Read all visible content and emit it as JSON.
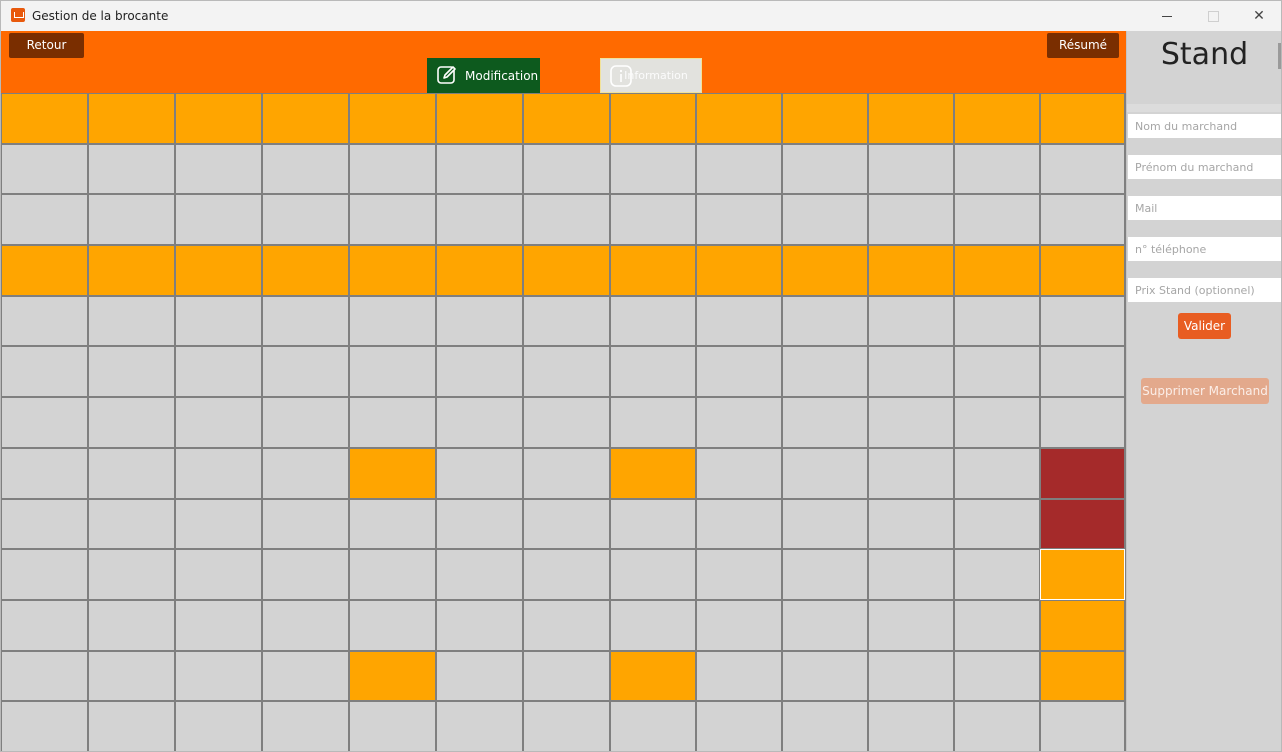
{
  "window": {
    "title": "Gestion de la brocante"
  },
  "toolbar": {
    "back_label": "Retour",
    "summary_label": "Résumé",
    "tab_modification": "Modification",
    "tab_information": "Information"
  },
  "panel": {
    "title": "Stand",
    "fields": {
      "nom_placeholder": "Nom du marchand",
      "prenom_placeholder": "Prénom du marchand",
      "mail_placeholder": "Mail",
      "telephone_placeholder": "n° téléphone",
      "prix_placeholder": "Prix Stand (optionnel)"
    },
    "validate_label": "Valider",
    "delete_label": "Supprimer Marchand"
  },
  "grid": {
    "rows": 13,
    "cols": 13,
    "colors": {
      "empty": "#d3d3d3",
      "stand": "#ffa500",
      "occupied": "#a52a2a"
    },
    "cells": [
      [
        "stand",
        "stand",
        "stand",
        "stand",
        "stand",
        "stand",
        "stand",
        "stand",
        "stand",
        "stand",
        "stand",
        "stand",
        "stand"
      ],
      [
        "empty",
        "empty",
        "empty",
        "empty",
        "empty",
        "empty",
        "empty",
        "empty",
        "empty",
        "empty",
        "empty",
        "empty",
        "empty"
      ],
      [
        "empty",
        "empty",
        "empty",
        "empty",
        "empty",
        "empty",
        "empty",
        "empty",
        "empty",
        "empty",
        "empty",
        "empty",
        "empty"
      ],
      [
        "stand",
        "stand",
        "stand",
        "stand",
        "stand",
        "stand",
        "stand",
        "stand",
        "stand",
        "stand",
        "stand",
        "stand",
        "stand"
      ],
      [
        "empty",
        "empty",
        "empty",
        "empty",
        "empty",
        "empty",
        "empty",
        "empty",
        "empty",
        "empty",
        "empty",
        "empty",
        "empty"
      ],
      [
        "empty",
        "empty",
        "empty",
        "empty",
        "empty",
        "empty",
        "empty",
        "empty",
        "empty",
        "empty",
        "empty",
        "empty",
        "empty"
      ],
      [
        "empty",
        "empty",
        "empty",
        "empty",
        "empty",
        "empty",
        "empty",
        "empty",
        "empty",
        "empty",
        "empty",
        "empty",
        "empty"
      ],
      [
        "empty",
        "empty",
        "empty",
        "empty",
        "stand",
        "empty",
        "empty",
        "stand",
        "empty",
        "empty",
        "empty",
        "empty",
        "occupied"
      ],
      [
        "empty",
        "empty",
        "empty",
        "empty",
        "empty",
        "empty",
        "empty",
        "empty",
        "empty",
        "empty",
        "empty",
        "empty",
        "occupied"
      ],
      [
        "empty",
        "empty",
        "empty",
        "empty",
        "empty",
        "empty",
        "empty",
        "empty",
        "empty",
        "empty",
        "empty",
        "empty",
        "stand-selected"
      ],
      [
        "empty",
        "empty",
        "empty",
        "empty",
        "empty",
        "empty",
        "empty",
        "empty",
        "empty",
        "empty",
        "empty",
        "empty",
        "stand"
      ],
      [
        "empty",
        "empty",
        "empty",
        "empty",
        "stand",
        "empty",
        "empty",
        "stand",
        "empty",
        "empty",
        "empty",
        "empty",
        "stand"
      ],
      [
        "empty",
        "empty",
        "empty",
        "empty",
        "empty",
        "empty",
        "empty",
        "empty",
        "empty",
        "empty",
        "empty",
        "empty",
        "empty"
      ]
    ]
  }
}
